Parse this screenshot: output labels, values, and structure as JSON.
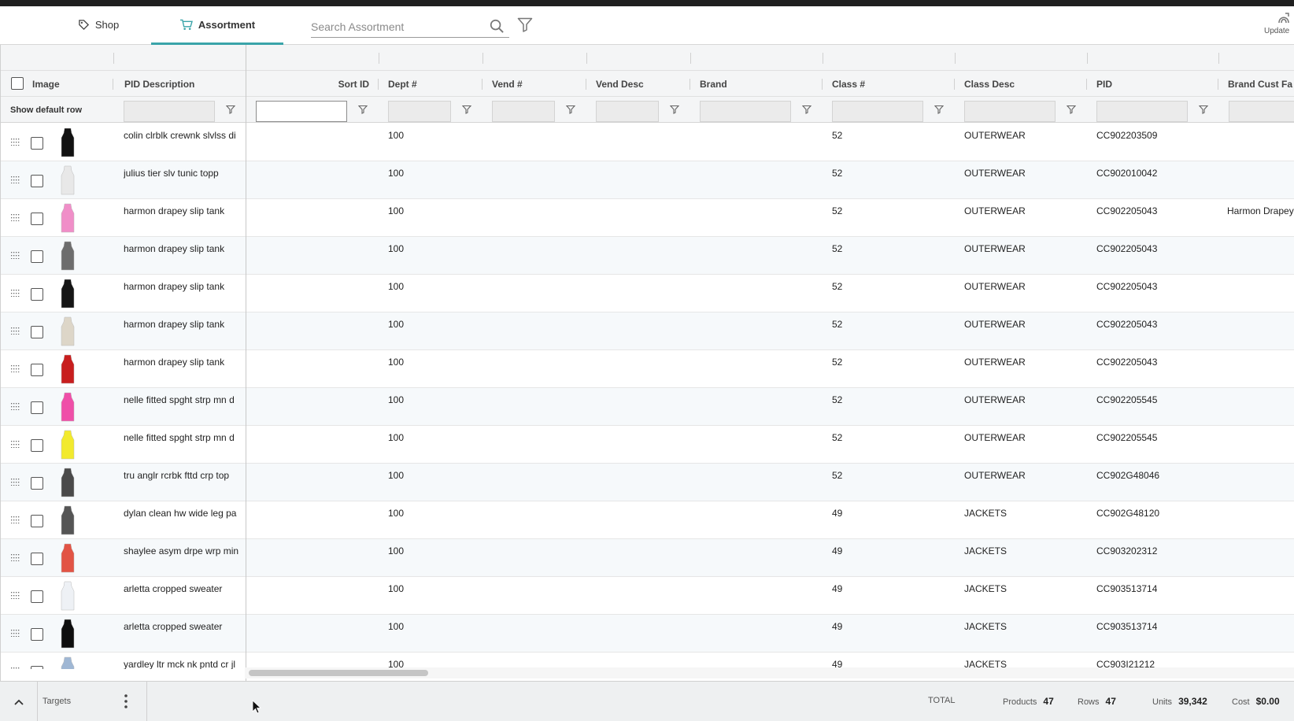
{
  "header": {
    "tabs": [
      {
        "label": "Shop",
        "icon": "tag-icon"
      },
      {
        "label": "Assortment",
        "icon": "cart-icon",
        "active": true
      }
    ],
    "search": {
      "placeholder": "Search Assortment",
      "value": ""
    },
    "update_label": "Update"
  },
  "grid": {
    "columns": [
      "Image",
      "PID Description",
      "Sort ID",
      "Dept #",
      "Vend #",
      "Vend Desc",
      "Brand",
      "Class #",
      "Class Desc",
      "PID",
      "Brand Cust Fa"
    ],
    "filter_row_label": "Show default row",
    "rows": [
      {
        "desc": "colin clrblk crewnk slvlss di",
        "dept": "100",
        "class_num": "52",
        "class_desc": "OUTERWEAR",
        "pid": "CC902203509",
        "brand_cust": "",
        "thumb": "#111111"
      },
      {
        "desc": "julius tier slv tunic topp",
        "dept": "100",
        "class_num": "52",
        "class_desc": "OUTERWEAR",
        "pid": "CC902010042",
        "brand_cust": "",
        "thumb": "#e8e8e8"
      },
      {
        "desc": "harmon drapey slip tank",
        "dept": "100",
        "class_num": "52",
        "class_desc": "OUTERWEAR",
        "pid": "CC902205043",
        "brand_cust": "Harmon Drapey",
        "thumb": "#f08ec8"
      },
      {
        "desc": "harmon drapey slip tank",
        "dept": "100",
        "class_num": "52",
        "class_desc": "OUTERWEAR",
        "pid": "CC902205043",
        "brand_cust": "",
        "thumb": "#6d6d6d"
      },
      {
        "desc": "harmon drapey slip tank",
        "dept": "100",
        "class_num": "52",
        "class_desc": "OUTERWEAR",
        "pid": "CC902205043",
        "brand_cust": "",
        "thumb": "#151515"
      },
      {
        "desc": "harmon drapey slip tank",
        "dept": "100",
        "class_num": "52",
        "class_desc": "OUTERWEAR",
        "pid": "CC902205043",
        "brand_cust": "",
        "thumb": "#ddd6c8"
      },
      {
        "desc": "harmon drapey slip tank",
        "dept": "100",
        "class_num": "52",
        "class_desc": "OUTERWEAR",
        "pid": "CC902205043",
        "brand_cust": "",
        "thumb": "#c81e1e"
      },
      {
        "desc": "nelle fitted spght strp mn d",
        "dept": "100",
        "class_num": "52",
        "class_desc": "OUTERWEAR",
        "pid": "CC902205545",
        "brand_cust": "",
        "thumb": "#ef4fa8"
      },
      {
        "desc": "nelle fitted spght strp mn d",
        "dept": "100",
        "class_num": "52",
        "class_desc": "OUTERWEAR",
        "pid": "CC902205545",
        "brand_cust": "",
        "thumb": "#f2ea2e"
      },
      {
        "desc": "tru anglr rcrbk fttd crp top",
        "dept": "100",
        "class_num": "52",
        "class_desc": "OUTERWEAR",
        "pid": "CC902G48046",
        "brand_cust": "",
        "thumb": "#4a4a4a"
      },
      {
        "desc": "dylan clean hw wide leg pa",
        "dept": "100",
        "class_num": "49",
        "class_desc": "JACKETS",
        "pid": "CC902G48120",
        "brand_cust": "",
        "thumb": "#555555"
      },
      {
        "desc": "shaylee asym drpe wrp min",
        "dept": "100",
        "class_num": "49",
        "class_desc": "JACKETS",
        "pid": "CC903202312",
        "brand_cust": "",
        "thumb": "#e25445"
      },
      {
        "desc": "arletta cropped sweater",
        "dept": "100",
        "class_num": "49",
        "class_desc": "JACKETS",
        "pid": "CC903513714",
        "brand_cust": "",
        "thumb": "#eef1f5"
      },
      {
        "desc": "arletta cropped sweater",
        "dept": "100",
        "class_num": "49",
        "class_desc": "JACKETS",
        "pid": "CC903513714",
        "brand_cust": "",
        "thumb": "#0e0e0e"
      },
      {
        "desc": "yardley ltr mck nk pntd cr jl",
        "dept": "100",
        "class_num": "49",
        "class_desc": "JACKETS",
        "pid": "CC903I21212",
        "brand_cust": "",
        "thumb": "#9fb7d4"
      }
    ]
  },
  "footer": {
    "targets_label": "Targets",
    "total_label": "TOTAL",
    "products_label": "Products",
    "products_value": "47",
    "rows_label": "Rows",
    "rows_value": "47",
    "units_label": "Units",
    "units_value": "39,342",
    "cost_label": "Cost",
    "cost_value": "$0.00"
  }
}
